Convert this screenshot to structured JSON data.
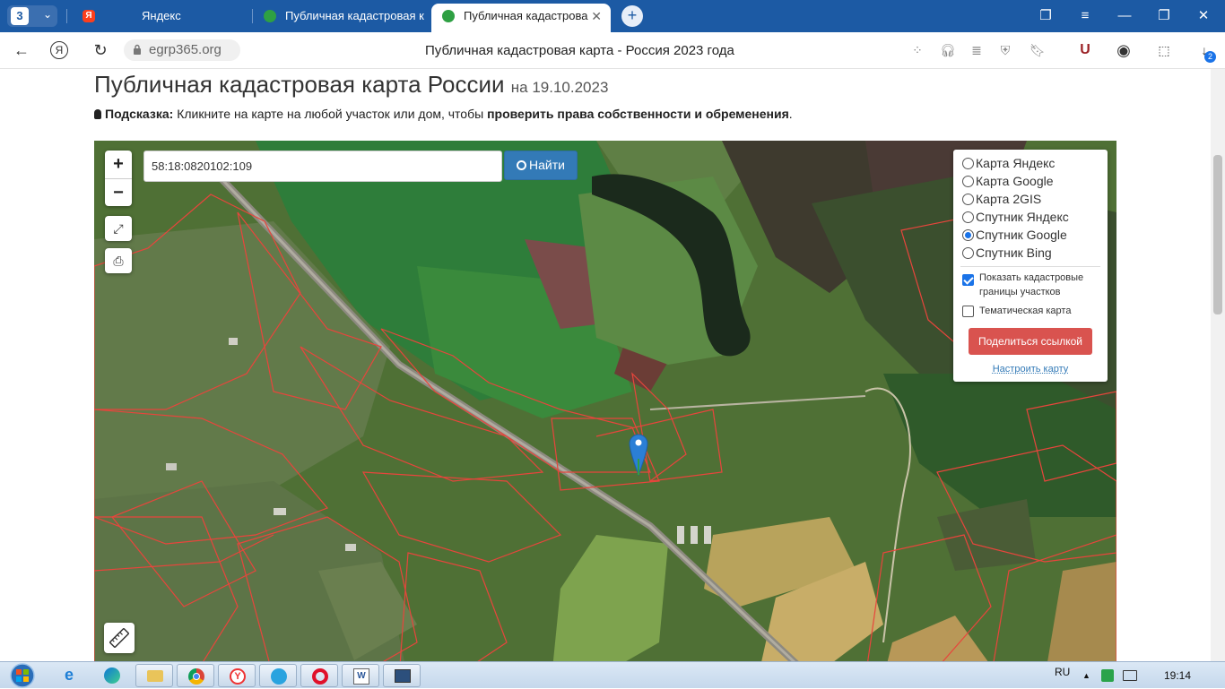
{
  "browser": {
    "tab_count": "3",
    "tabs": [
      {
        "label": "Яндекс",
        "icon": "yandex-icon"
      },
      {
        "label": "Публичная кадастровая к",
        "icon": "check-circle-icon"
      },
      {
        "label": "Публичная кадастрова",
        "icon": "check-circle-icon",
        "active": true
      }
    ],
    "url": "egrp365.org",
    "page_title": "Публичная кадастровая карта - Россия 2023 года",
    "downloads_badge": "2",
    "colors": {
      "tabbar": "#1c5aa4",
      "accent": "#337ab7",
      "danger": "#d9534f"
    }
  },
  "page": {
    "heading": "Публичная кадастровая карта России",
    "heading_date": "на 19.10.2023",
    "hint_label": "Подсказка:",
    "hint_text": "Кликните на карте на любой участок или дом, чтобы",
    "hint_bold": "проверить права собственности и обременения",
    "hint_end": "."
  },
  "map": {
    "zoom_in": "+",
    "zoom_out": "−",
    "search_value": "58:18:0820102:109",
    "search_button": "Найти",
    "layers": [
      {
        "label": "Карта Яндекс",
        "selected": false
      },
      {
        "label": "Карта Google",
        "selected": false
      },
      {
        "label": "Карта 2GIS",
        "selected": false
      },
      {
        "label": "Спутник Яндекс",
        "selected": false
      },
      {
        "label": "Спутник Google",
        "selected": true
      },
      {
        "label": "Спутник Bing",
        "selected": false
      }
    ],
    "show_cadastral_label": "Показать кадастровые границы участков",
    "show_cadastral_checked": true,
    "thematic_label": "Тематическая карта",
    "thematic_checked": false,
    "share_button": "Поделиться ссылкой",
    "configure_link": "Настроить карту"
  },
  "taskbar": {
    "lang": "RU",
    "time": "19:14"
  }
}
